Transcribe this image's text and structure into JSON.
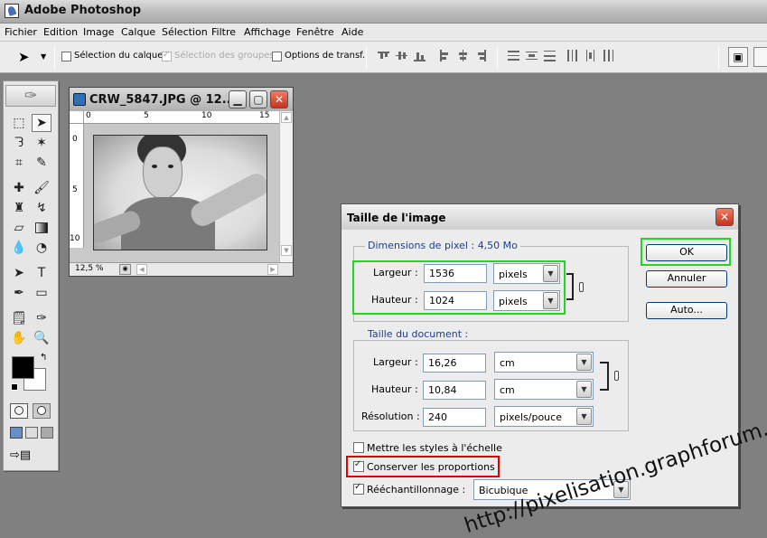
{
  "app": {
    "title": "Adobe Photoshop"
  },
  "menu": [
    "Fichier",
    "Edition",
    "Image",
    "Calque",
    "Sélection",
    "Filtre",
    "Affichage",
    "Fenêtre",
    "Aide"
  ],
  "options": {
    "auto_select_layer": "Sélection du calque",
    "auto_select_groups": "Sélection des groupes",
    "transform_options": "Options de transf."
  },
  "document": {
    "title": "CRW_5847.JPG @ 12...",
    "zoom": "12,5 %",
    "ruler_top": [
      "0",
      "5",
      "10",
      "15"
    ],
    "ruler_left": [
      "0",
      "5",
      "10"
    ]
  },
  "dialog": {
    "title": "Taille de l'image",
    "pixel_dims_legend": "Dimensions de pixel : ",
    "pixel_dims_size": "4,50 Mo",
    "width_label": "Largeur :",
    "height_label": "Hauteur :",
    "px_width": "1536",
    "px_height": "1024",
    "px_width_unit": "pixels",
    "px_height_unit": "pixels",
    "doc_legend": "Taille du document :",
    "doc_width": "16,26",
    "doc_height": "10,84",
    "doc_width_unit": "cm",
    "doc_height_unit": "cm",
    "resolution_label": "Résolution :",
    "resolution": "240",
    "resolution_unit": "pixels/pouce",
    "scale_styles": "Mettre les styles à l'échelle",
    "constrain": "Conserver les proportions",
    "resample": "Rééchantillonnage :",
    "resample_method": "Bicubique",
    "ok": "OK",
    "cancel": "Annuler",
    "auto": "Auto..."
  },
  "watermark": "http://pixelisation.graphforum.com",
  "colors": {
    "highlight": "#22d622",
    "redbox": "#e00000",
    "legend": "#1e3d8f"
  }
}
